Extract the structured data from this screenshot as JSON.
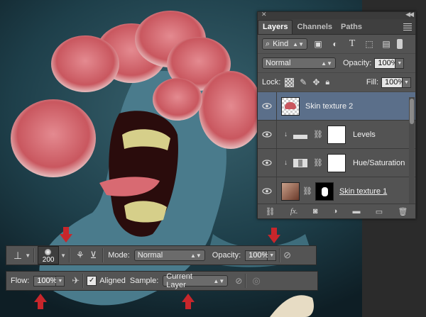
{
  "layers_panel": {
    "tabs": [
      "Layers",
      "Channels",
      "Paths"
    ],
    "kind_label": "Kind",
    "blend_mode": "Normal",
    "opacity_label": "Opacity:",
    "opacity_value": "100%",
    "lock_label": "Lock:",
    "fill_label": "Fill:",
    "fill_value": "100%",
    "layers": [
      {
        "name": "Skin texture 2",
        "selected": true
      },
      {
        "name": "Levels",
        "selected": false
      },
      {
        "name": "Hue/Saturation",
        "selected": false
      },
      {
        "name": "Skin texture 1",
        "selected": false
      }
    ]
  },
  "options_bar": {
    "brush_size": "200",
    "mode_label": "Mode:",
    "mode_value": "Normal",
    "opacity_label": "Opacity:",
    "opacity_value": "100%",
    "flow_label": "Flow:",
    "flow_value": "100%",
    "aligned_label": "Aligned",
    "sample_label": "Sample:",
    "sample_value": "Current Layer"
  },
  "colors": {
    "panel_bg": "#535353",
    "selected_layer": "#5b6f8a",
    "arrow": "#c8262b",
    "canvas_bg": "#1a3540"
  }
}
